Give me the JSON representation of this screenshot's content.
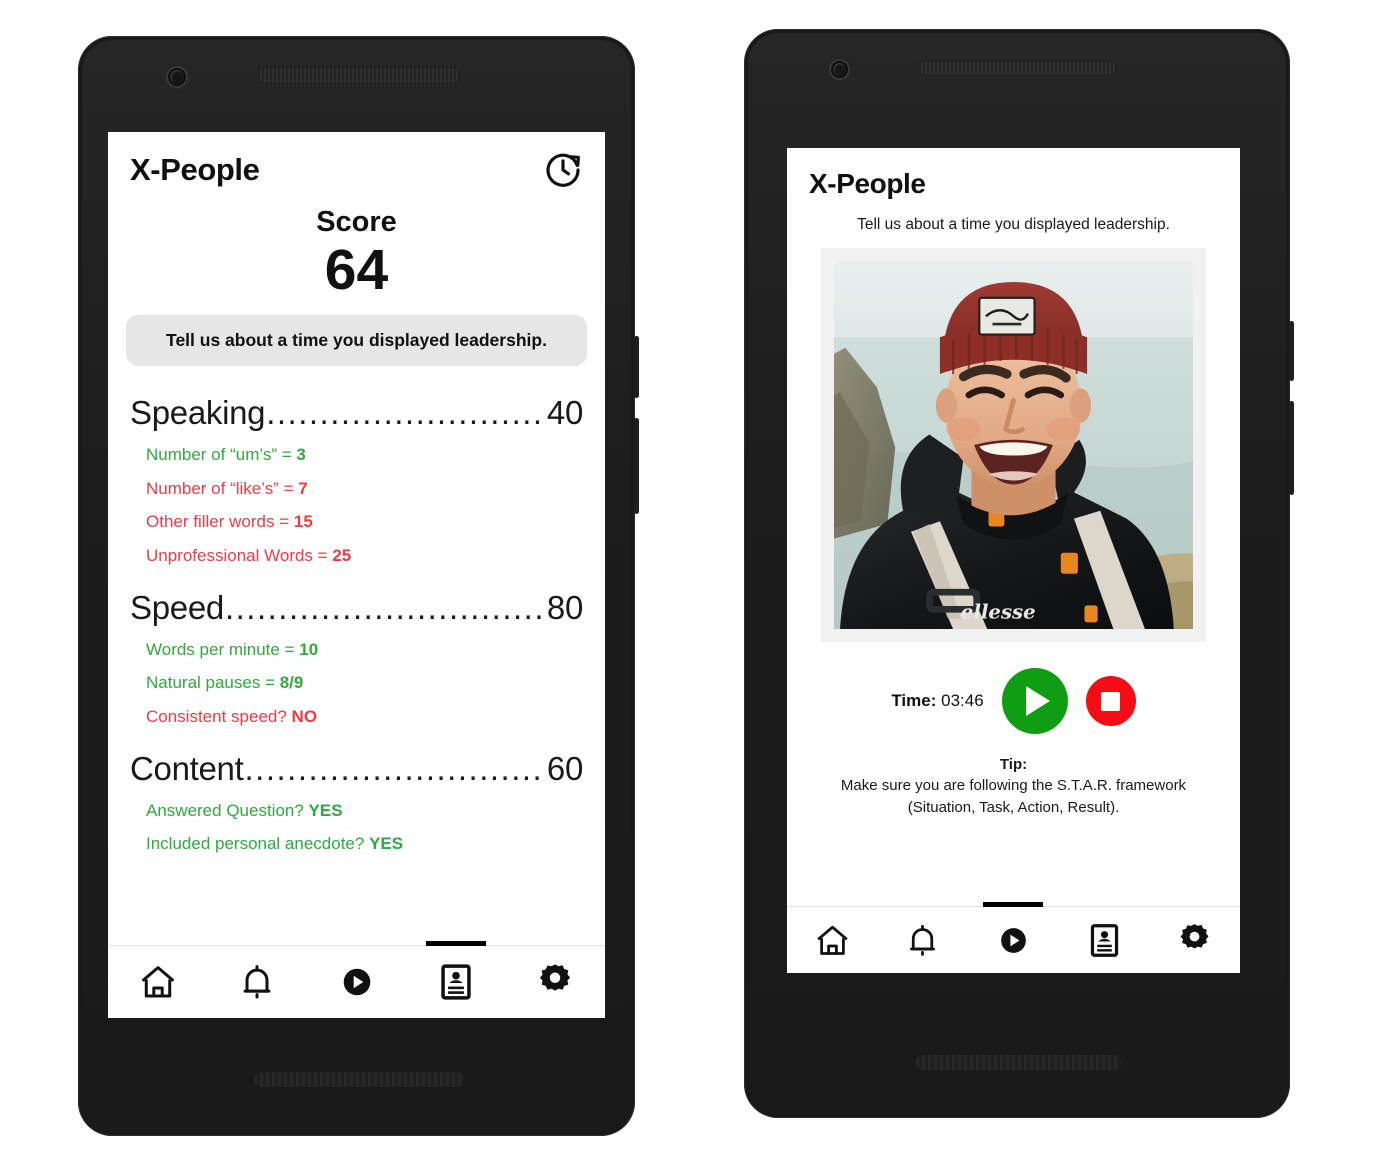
{
  "app": {
    "name": "X-People",
    "accent_green": "#2eaa3e",
    "accent_red": "#ef3b44",
    "play_green": "#0f9d12",
    "stop_red": "#f60c14",
    "question_box_bg": "#e6e6e6"
  },
  "left_phone": {
    "header": {
      "title": "X-People",
      "history_icon": "clock-history-icon"
    },
    "score": {
      "label": "Score",
      "value": "64"
    },
    "question": "Tell us about a time you displayed leadership.",
    "sections": [
      {
        "name": "Speaking",
        "dots": "..........................................................",
        "score": "40",
        "items": [
          {
            "text": "Number of “um’s” = ",
            "value": "3",
            "status": "good"
          },
          {
            "text": "Number of “like’s” = ",
            "value": "7",
            "status": "bad"
          },
          {
            "text": "Other filler words = ",
            "value": "15",
            "status": "bad"
          },
          {
            "text": "Unprofessional Words = ",
            "value": "25",
            "status": "bad"
          }
        ]
      },
      {
        "name": "Speed",
        "dots": "..........................................................",
        "score": "80",
        "items": [
          {
            "text": "Words per minute = ",
            "value": "10",
            "status": "good"
          },
          {
            "text": "Natural pauses = ",
            "value": "8/9",
            "status": "good"
          },
          {
            "text": "Consistent speed? ",
            "value": "NO",
            "status": "bad"
          }
        ]
      },
      {
        "name": "Content",
        "dots": "..........................................................",
        "score": "60",
        "items": [
          {
            "text": "Answered Question? ",
            "value": "YES",
            "status": "good"
          },
          {
            "text": "Included personal anecdote? ",
            "value": "YES",
            "status": "good"
          }
        ]
      }
    ],
    "nav": {
      "active_index": 3,
      "items": [
        {
          "icon": "home-icon",
          "label": "Home"
        },
        {
          "icon": "bell-icon",
          "label": "Notifications"
        },
        {
          "icon": "play-circle-icon",
          "label": "Record"
        },
        {
          "icon": "id-card-icon",
          "label": "Profile"
        },
        {
          "icon": "gear-icon",
          "label": "Settings"
        }
      ]
    }
  },
  "right_phone": {
    "header": {
      "title": "X-People"
    },
    "question": "Tell us about a time you displayed leadership.",
    "photo": {
      "name": "user-video-preview",
      "alt": "Smiling man in a dark red beanie and black puffer jacket with a backpack, coastline behind him"
    },
    "controls": {
      "time_label": "Time:",
      "time_value": "03:46",
      "play_icon": "play-icon",
      "stop_icon": "stop-icon"
    },
    "tip": {
      "title": "Tip:",
      "line1": "Make sure you are following the S.T.A.R. framework",
      "line2": "(Situation, Task, Action, Result)."
    },
    "nav": {
      "active_index": 2,
      "items": [
        {
          "icon": "home-icon",
          "label": "Home"
        },
        {
          "icon": "bell-icon",
          "label": "Notifications"
        },
        {
          "icon": "play-circle-icon",
          "label": "Record"
        },
        {
          "icon": "id-card-icon",
          "label": "Profile"
        },
        {
          "icon": "gear-icon",
          "label": "Settings"
        }
      ]
    }
  }
}
